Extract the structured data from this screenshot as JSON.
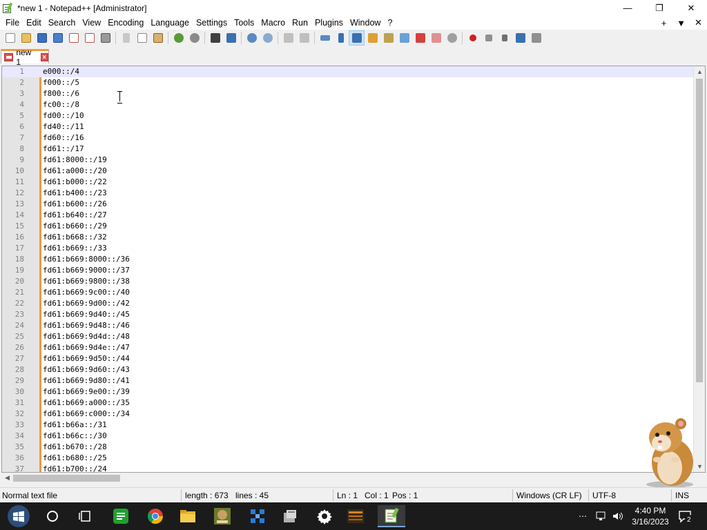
{
  "window": {
    "title": "*new 1 - Notepad++ [Administrator]",
    "minimize": "—",
    "restore": "❐",
    "close": "✕"
  },
  "menu": {
    "items": [
      "File",
      "Edit",
      "Search",
      "View",
      "Encoding",
      "Language",
      "Settings",
      "Tools",
      "Macro",
      "Run",
      "Plugins",
      "Window",
      "?"
    ],
    "right": [
      "+",
      "▼",
      "✕"
    ]
  },
  "tab": {
    "label": "new 1",
    "close": "×"
  },
  "editor": {
    "lines": [
      "e000::/4",
      "f000::/5",
      "f800::/6",
      "fc00::/8",
      "fd00::/10",
      "fd40::/11",
      "fd60::/16",
      "fd61::/17",
      "fd61:8000::/19",
      "fd61:a000::/20",
      "fd61:b000::/22",
      "fd61:b400::/23",
      "fd61:b600::/26",
      "fd61:b640::/27",
      "fd61:b660::/29",
      "fd61:b668::/32",
      "fd61:b669::/33",
      "fd61:b669:8000::/36",
      "fd61:b669:9000::/37",
      "fd61:b669:9800::/38",
      "fd61:b669:9c00::/40",
      "fd61:b669:9d00::/42",
      "fd61:b669:9d40::/45",
      "fd61:b669:9d48::/46",
      "fd61:b669:9d4d::/48",
      "fd61:b669:9d4e::/47",
      "fd61:b669:9d50::/44",
      "fd61:b669:9d60::/43",
      "fd61:b669:9d80::/41",
      "fd61:b669:9e00::/39",
      "fd61:b669:a000::/35",
      "fd61:b669:c000::/34",
      "fd61:b66a::/31",
      "fd61:b66c::/30",
      "fd61:b670::/28",
      "fd61:b680::/25",
      "fd61:b700::/24"
    ],
    "current_line": 1
  },
  "status": {
    "file_type": "Normal text file",
    "length": "length : 673",
    "lines": "lines : 45",
    "ln": "Ln : 1",
    "col": "Col : 1",
    "pos": "Pos : 1",
    "eol": "Windows (CR LF)",
    "encoding": "UTF-8",
    "mode": "INS"
  },
  "taskbar": {
    "time": "4:40 PM",
    "date": "3/16/2023",
    "notifications": "2",
    "overflow": "⋯",
    "icons": [
      "start-icon",
      "cortana-icon",
      "task-view-icon",
      "spreadsheet-app-icon",
      "chrome-icon",
      "file-explorer-icon",
      "game-app-icon",
      "network-app-icon",
      "package-app-icon",
      "settings-icon",
      "media-app-icon",
      "notepad-plus-plus-icon"
    ]
  },
  "colors": {
    "accent_orange": "#f29a3a",
    "current_line": "#e8e8ff",
    "gutter": "#e4e4e4",
    "taskbar": "#1b1b1b"
  }
}
